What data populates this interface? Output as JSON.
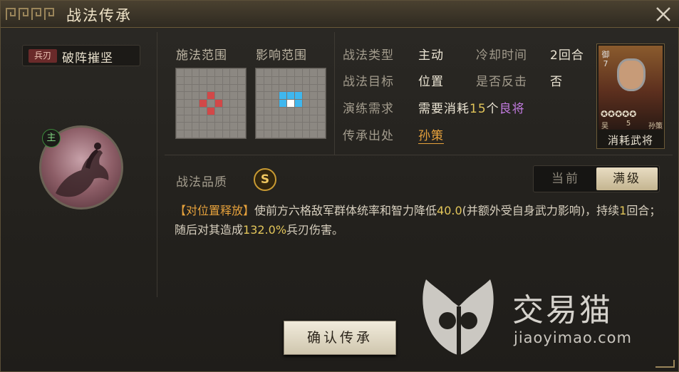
{
  "window": {
    "title": "战法传承"
  },
  "skill": {
    "tag": "兵刃",
    "name": "破阵摧坚",
    "role_badge": "主"
  },
  "ranges": {
    "cast_label": "施法范围",
    "effect_label": "影响范围"
  },
  "info": {
    "type_label": "战法类型",
    "type_value": "主动",
    "cooldown_label": "冷却时间",
    "cooldown_value": "2回合",
    "target_label": "战法目标",
    "target_value": "位置",
    "counter_label": "是否反击",
    "counter_value": "否",
    "train_label": "演练需求",
    "train_prefix": "需要消耗",
    "train_count": "15",
    "train_unit": "个",
    "train_quality": "良将",
    "source_label": "传承出处",
    "source_value": "孙策"
  },
  "card": {
    "rank": "御7",
    "faction": "吴",
    "cost": "5",
    "hero": "孙策",
    "stars": "✪✪✪✪✪",
    "caption": "消耗武将"
  },
  "quality": {
    "label": "战法品质",
    "grade": "S"
  },
  "toggle": {
    "current": "当前",
    "max": "满级"
  },
  "description": {
    "tag": "【对位置释放】",
    "part1": "使前方六格敌军群体统率和智力降低",
    "value1": "40.0",
    "part2": "(并额外受自身武力影响)，持续",
    "value2": "1",
    "part3": "回合；随后对其造成",
    "value3": "132.0%",
    "part4": "兵刃伤害。"
  },
  "confirm_button": "确认传承",
  "watermark": {
    "name": "交易猫",
    "url": "jiaoyimao.com"
  },
  "colors": {
    "accent": "#e7a23c",
    "number": "#e3c65a",
    "quality_purple": "#c27be0",
    "cast_red": "#d24848",
    "effect_blue": "#3fb7ee"
  }
}
